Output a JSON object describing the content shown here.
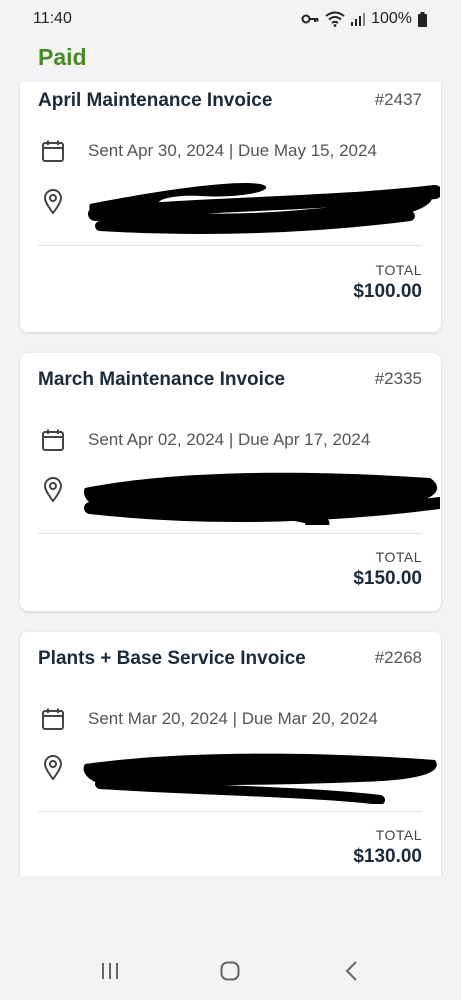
{
  "status_bar": {
    "time": "11:40",
    "battery": "100%"
  },
  "section": {
    "title": "Paid"
  },
  "invoices": [
    {
      "title": "April Maintenance Invoice",
      "number": "#2437",
      "dates": "Sent Apr 30, 2024 | Due May 15, 2024",
      "total_label": "TOTAL",
      "total": "$100.00"
    },
    {
      "title": "March Maintenance Invoice",
      "number": "#2335",
      "dates": "Sent Apr 02, 2024 | Due Apr 17, 2024",
      "total_label": "TOTAL",
      "total": "$150.00"
    },
    {
      "title": "Plants + Base Service Invoice",
      "number": "#2268",
      "dates": "Sent Mar 20, 2024 | Due Mar 20, 2024",
      "total_label": "TOTAL",
      "total": "$130.00"
    }
  ]
}
